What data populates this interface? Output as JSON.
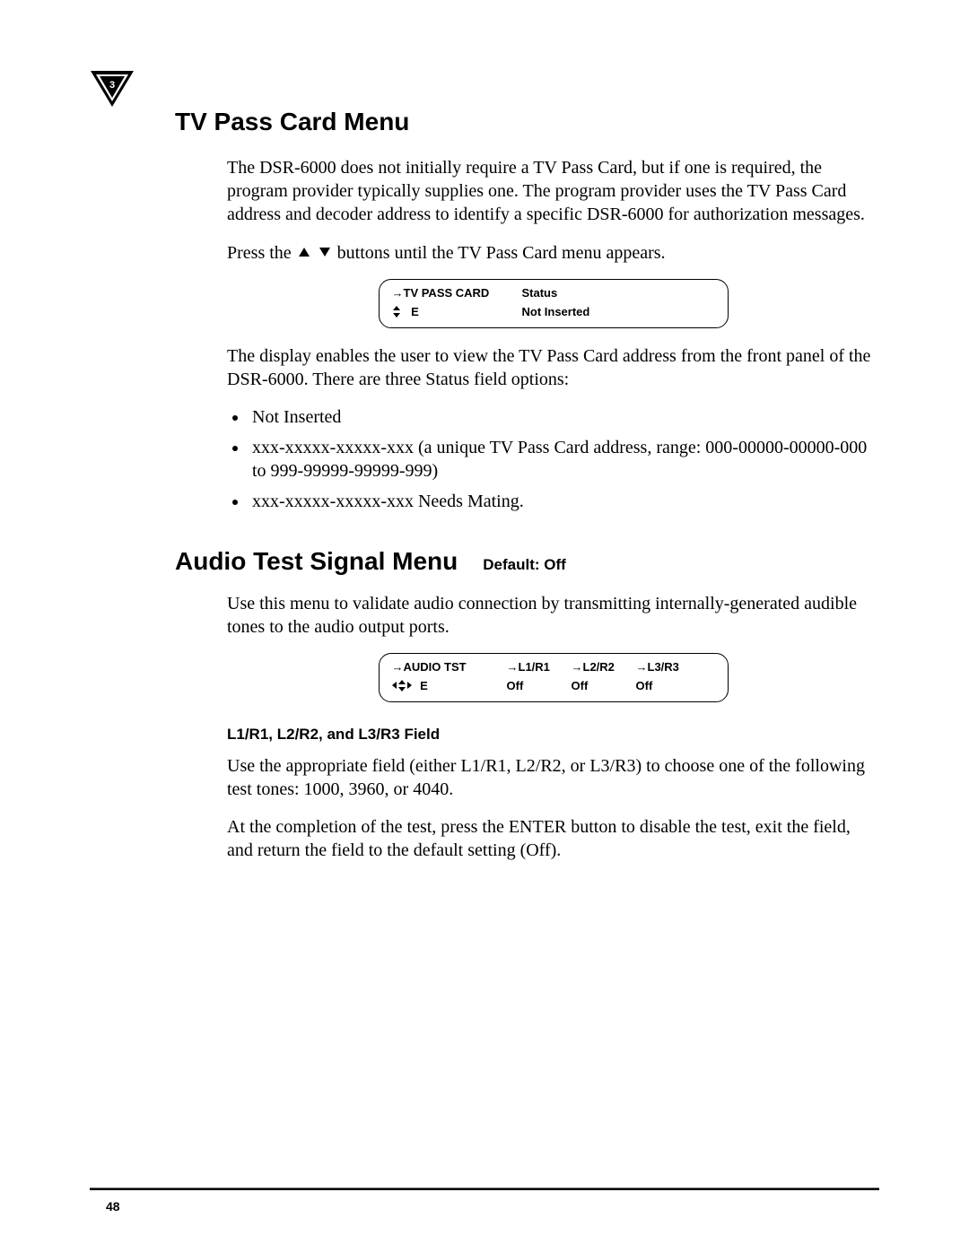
{
  "chapter_number": "3",
  "page_number": "48",
  "section1": {
    "heading": "TV Pass Card Menu",
    "para1": "The DSR-6000 does not initially require a TV Pass Card, but if one is required, the program provider typically supplies one. The program provider uses the TV Pass Card address and decoder address to identify a specific DSR-6000 for authorization messages.",
    "para2_prefix": "Press the ",
    "para2_suffix": " buttons until the TV Pass Card menu appears.",
    "lcd": {
      "row1": {
        "c1": "→TV PASS CARD",
        "c2": "Status"
      },
      "row2": {
        "c1_indicator": "updown",
        "c1_letter": "E",
        "c2": "Not Inserted"
      }
    },
    "para3": "The display enables the user to view the TV Pass Card address from the front panel of the DSR-6000. There are three Status field options:",
    "bullets": [
      "Not Inserted",
      "xxx-xxxxx-xxxxx-xxx (a unique TV Pass Card address, range: 000-00000-00000-000 to 999-99999-99999-999)",
      "xxx-xxxxx-xxxxx-xxx Needs Mating."
    ]
  },
  "section2": {
    "heading": "Audio Test Signal Menu",
    "default_label": "Default: Off",
    "para1": "Use this menu to validate audio connection by transmitting internally-generated audible tones to the audio output ports.",
    "lcd": {
      "row1": {
        "c1": "→AUDIO TST",
        "c2": "→L1/R1",
        "c3": "→L2/R2",
        "c4": "→L3/R3"
      },
      "row2": {
        "c1_indicator": "leftright",
        "c1_letter": "E",
        "c2": "Off",
        "c3": "Off",
        "c4": "Off"
      }
    },
    "subheading": "L1/R1, L2/R2, and L3/R3 Field",
    "para2": "Use the appropriate field (either L1/R1, L2/R2, or L3/R3) to choose one of the following test tones: 1000, 3960, or 4040.",
    "para3": "At the completion of the test, press the ENTER button to disable the test, exit the field, and return the field to the default setting (Off)."
  }
}
